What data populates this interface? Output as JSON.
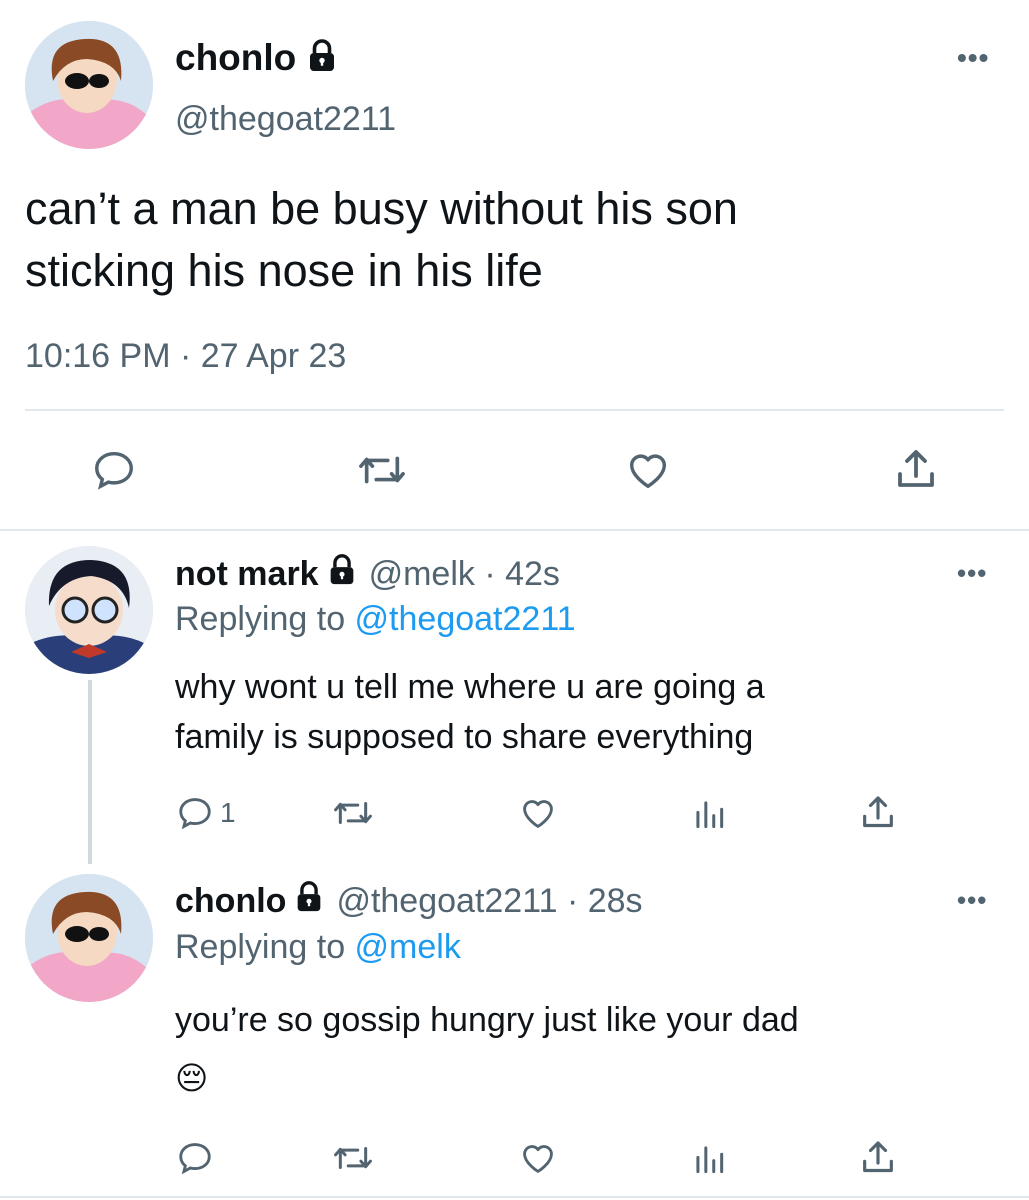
{
  "main_tweet": {
    "display_name": "chonlo",
    "handle": "@thegoat2211",
    "text_line1": "can’t a man be busy without his son",
    "text_line2": "sticking his nose in his life",
    "timestamp": "10:16 PM · 27 Apr 23"
  },
  "replies": [
    {
      "display_name": "not mark",
      "handle_time": "@melk · 42s",
      "replying_prefix": "Replying to ",
      "replying_to": "@thegoat2211",
      "text_line1": "why wont u tell me where u are going a",
      "text_line2": "family is supposed to share everything",
      "reply_count": "1"
    },
    {
      "display_name": "chonlo",
      "handle_time": "@thegoat2211 · 28s",
      "replying_prefix": "Replying to ",
      "replying_to": "@melk",
      "text_line1": "you’re so gossip hungry just like your dad",
      "emoji": "😔",
      "reply_count": ""
    }
  ],
  "icons": [
    "lock-icon",
    "more-icon",
    "reply-icon",
    "retweet-icon",
    "like-icon",
    "share-icon",
    "analytics-icon"
  ],
  "colors": {
    "accent": "#1d9bf0",
    "secondary_text": "#536471",
    "divider": "#e1e8ed"
  }
}
